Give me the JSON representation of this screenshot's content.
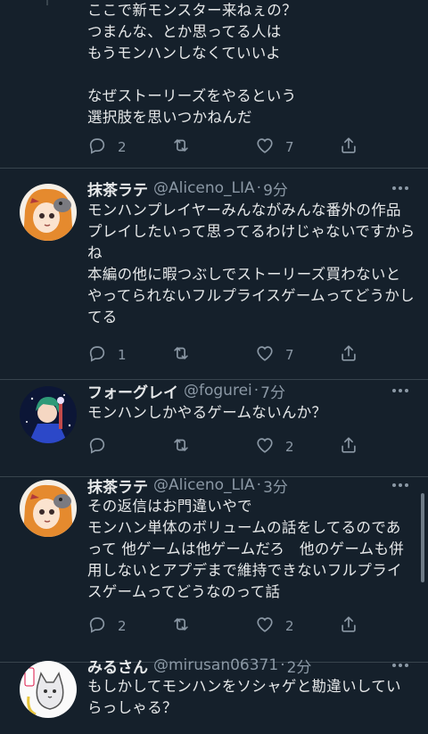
{
  "tweets": [
    {
      "name": "",
      "handle": "",
      "time": "",
      "text": "ここで新モンスター来ねぇの？\nつまんな、とか思ってる人は\nもうモンハンしなくていいよ\n\nなぜストーリーズをやるという\n選択肢を思いつかねんだ",
      "replies": "2",
      "retweets": "",
      "likes": "7"
    },
    {
      "name": "抹茶ラテ",
      "handle": "@Aliceno_LIA",
      "time": "9分",
      "text": "モンハンプレイヤーみんながみんな番外の作品プレイしたいって思ってるわけじゃないですからね\n本編の他に暇つぶしでストーリーズ買わないとやってられないフルプライスゲームってどうかしてる",
      "replies": "1",
      "retweets": "",
      "likes": "7"
    },
    {
      "name": "フォーグレイ",
      "handle": "@fogurei",
      "time": "7分",
      "text": "モンハンしかやるゲームないんか？",
      "replies": "",
      "retweets": "",
      "likes": "2"
    },
    {
      "name": "抹茶ラテ",
      "handle": "@Aliceno_LIA",
      "time": "3分",
      "text": "その返信はお門違いやで\nモンハン単体のボリュームの話をしてるのであって 他ゲームは他ゲームだろ　他のゲームも併用しないとアプデまで維持できないフルプライスゲームってどうなのって話",
      "replies": "2",
      "retweets": "",
      "likes": "2"
    },
    {
      "name": "みるさん",
      "handle": "@mirusan06371",
      "time": "2分",
      "text": "もしかしてモンハンをソシャゲと勘違いしていらっしゃる？"
    }
  ],
  "separator": "·",
  "colors": {
    "background": "#15202b",
    "text": "#e7e9ea",
    "muted": "#8b98a5",
    "border": "#38444d"
  }
}
